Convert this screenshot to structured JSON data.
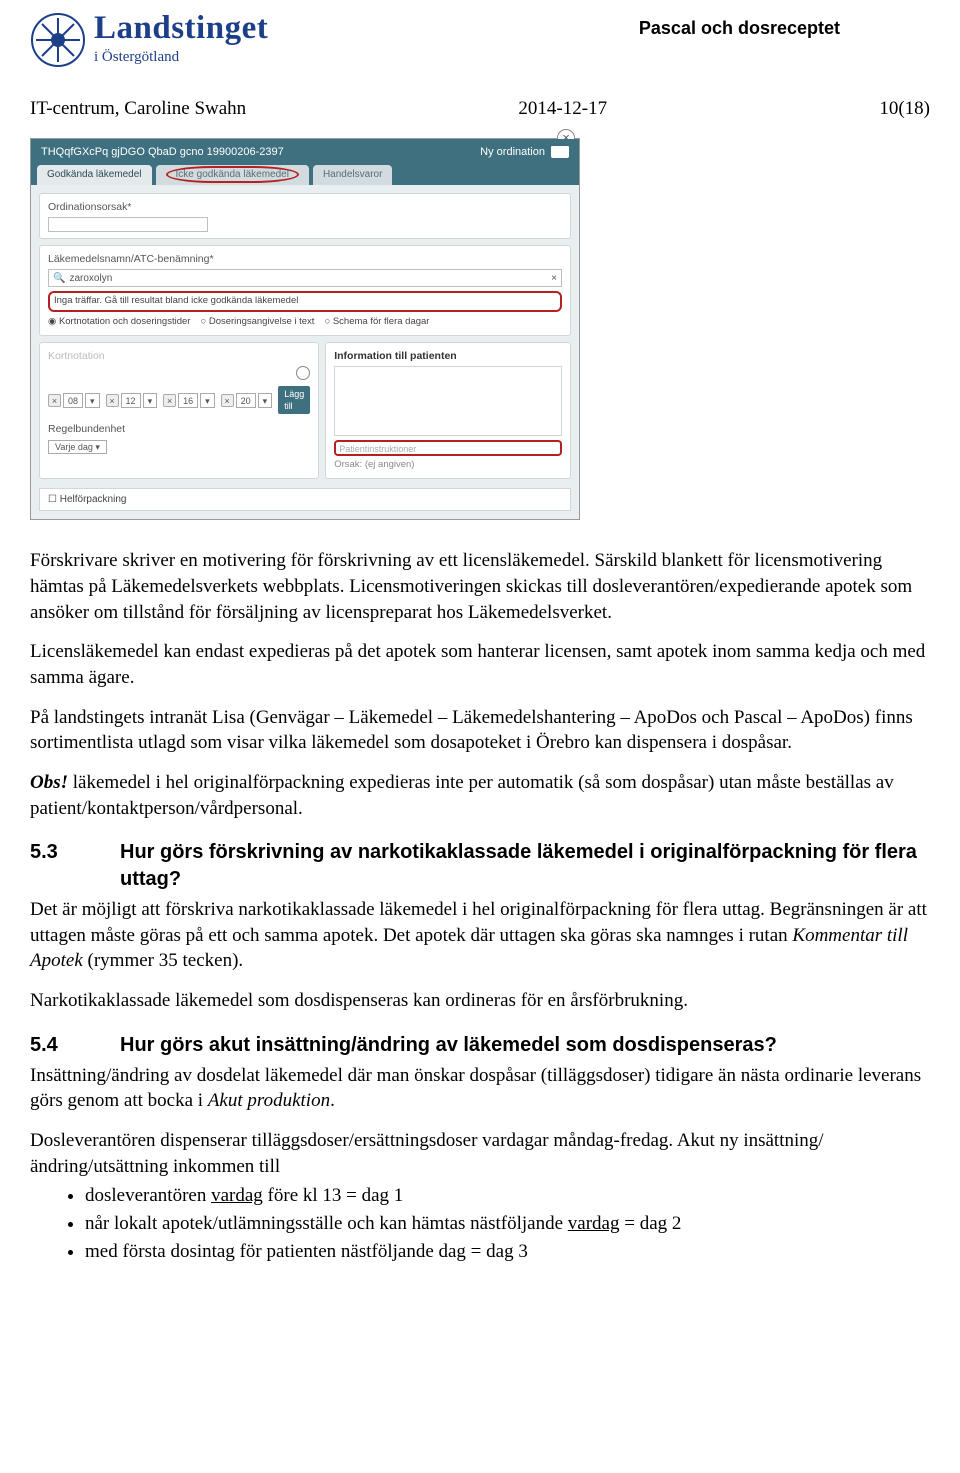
{
  "header": {
    "logo_main": "Landstinget",
    "logo_sub": "i Östergötland",
    "doc_title": "Pascal och dosreceptet"
  },
  "meta": {
    "author": "IT-centrum, Caroline Swahn",
    "date": "2014-12-17",
    "page": "10(18)"
  },
  "shot": {
    "patient_id": "THQqfGXcPq gjDGO QbaD gcno 19900206-2397",
    "header_right": "Ny ordination",
    "tab1": "Godkända läkemedel",
    "tab2": "Icke godkända läkemedel",
    "tab3": "Handelsvaror",
    "field_ordorsak": "Ordinationsorsak*",
    "field_name": "Läkemedelsnamn/ATC-benämning*",
    "search_value": "zaroxolyn",
    "nohits": "Inga träffar. Gå till resultat bland icke godkända läkemedel",
    "radio1": "Kortnotation och doseringstider",
    "radio2": "Doseringsangivelse i text",
    "radio3": "Schema för flera dagar",
    "kortnot": "Kortnotation",
    "times": [
      "08",
      "12",
      "16",
      "20"
    ],
    "laggtill": "Lägg till",
    "info_label": "Information till patienten",
    "patinstr": "Patientinstruktioner",
    "orsak": "Orsak: (ej angiven)",
    "regel_label": "Regelbundenhet",
    "regel_value": "Varje dag",
    "helfor": "Helförpackning"
  },
  "body": {
    "p1": "Förskrivare skriver en motivering för förskrivning av ett licensläkemedel. Särskild blankett för licensmotivering hämtas på Läkemedelsverkets webbplats. Licensmotiveringen skickas till dosleverantören/expedierande apotek som ansöker om tillstånd för försäljning av licenspreparat hos Läkemedelsverket.",
    "p2": "Licensläkemedel kan endast expedieras på det apotek som hanterar licensen, samt apotek inom samma kedja och med samma ägare.",
    "p3": "På landstingets intranät Lisa (Genvägar – Läkemedel – Läkemedelshantering – ApoDos och Pascal – ApoDos) finns sortimentlista utlagd som visar vilka läkemedel som dosapoteket i Örebro kan dispensera i dospåsar.",
    "p4_obs": "Obs!",
    "p4_rest": " läkemedel i hel originalförpackning expedieras inte per automatik (så som dospåsar) utan måste beställas av patient/kontaktperson/vårdpersonal.",
    "h53_num": "5.3",
    "h53_txt": "Hur görs förskrivning av narkotikaklassade läkemedel i originalförpackning för flera uttag?",
    "p5_a": "Det är möjligt att förskriva narkotikaklassade läkemedel i hel originalförpackning för flera uttag. Begränsningen är att uttagen måste göras på ett och samma apotek. Det apotek där uttagen ska göras ska namnges i rutan ",
    "p5_i": "Kommentar till Apotek",
    "p5_b": " (rymmer 35 tecken).",
    "p6": "Narkotikaklassade läkemedel som dosdispenseras kan ordineras för en årsförbrukning.",
    "h54_num": "5.4",
    "h54_txt": "Hur görs akut insättning/ändring av läkemedel som dosdispenseras?",
    "p7_a": "Insättning/ändring av dosdelat läkemedel där man önskar dospåsar (tilläggsdoser) tidigare än nästa ordinarie leverans görs genom att bocka i ",
    "p7_i": "Akut produktion",
    "p7_b": ".",
    "p8": "Dosleverantören dispenserar tilläggsdoser/ersättningsdoser vardagar måndag-fredag. Akut ny insättning/ändring/utsättning inkommen till",
    "li1_a": "dosleverantören ",
    "li1_u": "vardag",
    "li1_b": " före kl 13 = dag 1",
    "li2_a": "når lokalt apotek/utlämningsställe och kan hämtas nästföljande ",
    "li2_u": "vardag",
    "li2_b": " = dag 2",
    "li3": "med första dosintag för patienten nästföljande dag = dag 3"
  }
}
